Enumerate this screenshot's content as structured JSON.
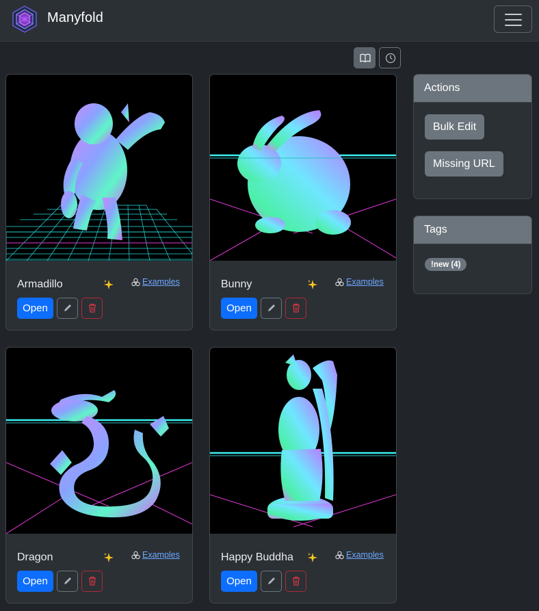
{
  "app": {
    "brand_name": "Manyfold",
    "brand_logo_icon": "manyfold-hexagon-logo",
    "menu_icon": "hamburger-icon"
  },
  "view_toggles": [
    {
      "icon": "book-icon",
      "active": true
    },
    {
      "icon": "clock-icon",
      "active": false
    }
  ],
  "models": [
    {
      "title": "Armadillo",
      "collection": "Examples",
      "open_label": "Open",
      "new_icon": "sparkles-icon"
    },
    {
      "title": "Bunny",
      "collection": "Examples",
      "open_label": "Open",
      "new_icon": "sparkles-icon"
    },
    {
      "title": "Dragon",
      "collection": "Examples",
      "open_label": "Open",
      "new_icon": "sparkles-icon"
    },
    {
      "title": "Happy Buddha",
      "collection": "Examples",
      "open_label": "Open",
      "new_icon": "sparkles-icon"
    }
  ],
  "actions": {
    "title": "Actions",
    "bulk_edit": "Bulk Edit",
    "missing_url": "Missing URL"
  },
  "tags": {
    "title": "Tags",
    "items": [
      "!new (4)"
    ]
  },
  "colors": {
    "accent": "#0d6efd",
    "danger": "#dc3545",
    "link": "#6ea8fe",
    "secondary": "#6c757d",
    "background": "#212529"
  }
}
